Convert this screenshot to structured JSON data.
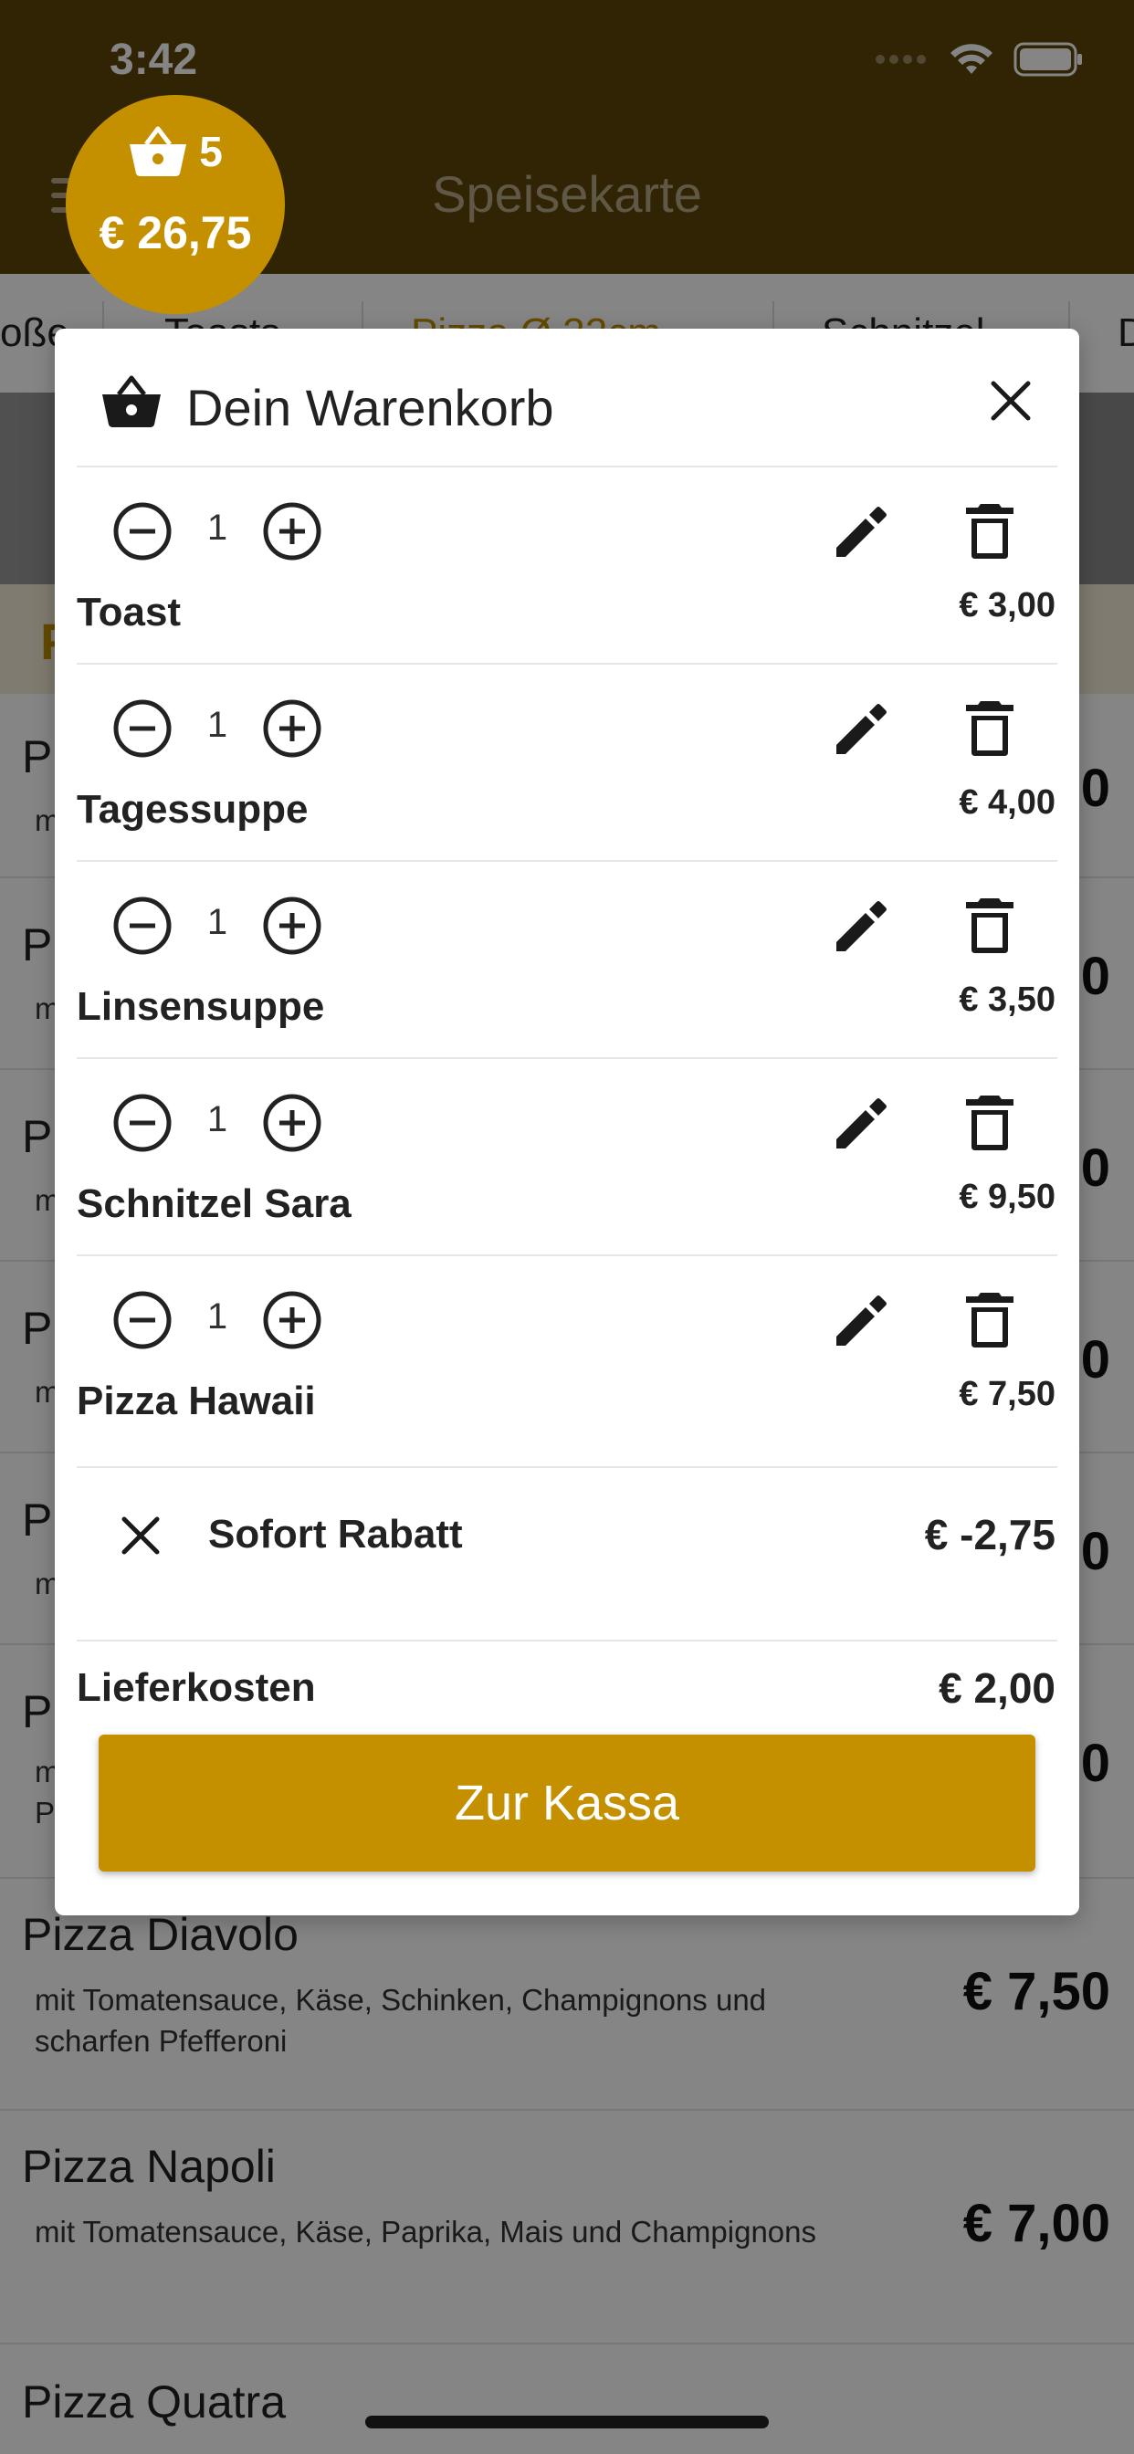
{
  "status_bar": {
    "time": "3:42"
  },
  "header": {
    "title": "Speisekarte"
  },
  "categories": [
    "oße",
    "Toasts",
    "Pizza Ø 32cm",
    "Schnitzel",
    "D"
  ],
  "section_heading": "P",
  "menu": [
    {
      "name": "P",
      "desc": "m",
      "price": "0"
    },
    {
      "name": "P",
      "desc": "m",
      "price": "0"
    },
    {
      "name": "P",
      "desc": "m",
      "price": "0"
    },
    {
      "name": "P",
      "desc": "m",
      "price": "0"
    },
    {
      "name": "P",
      "desc": "m",
      "price": "0"
    },
    {
      "name": "P",
      "desc": "m\nP",
      "price": "0"
    },
    {
      "name": "Pizza Diavolo",
      "desc": "mit Tomatensauce, Käse, Schinken, Champignons und scharfen Pfefferoni",
      "price": "€ 7,50"
    },
    {
      "name": "Pizza Napoli",
      "desc": "mit Tomatensauce, Käse, Paprika, Mais und Champignons",
      "price": "€ 7,00"
    },
    {
      "name": "Pizza Quatra",
      "desc": "",
      "price": ""
    }
  ],
  "cart_badge": {
    "count": "5",
    "total": "€ 26,75"
  },
  "cart": {
    "title": "Dein Warenkorb",
    "items": [
      {
        "qty": "1",
        "name": "Toast",
        "price": "€ 3,00"
      },
      {
        "qty": "1",
        "name": "Tagessuppe",
        "price": "€ 4,00"
      },
      {
        "qty": "1",
        "name": "Linsensuppe",
        "price": "€ 3,50"
      },
      {
        "qty": "1",
        "name": "Schnitzel Sara",
        "price": "€ 9,50"
      },
      {
        "qty": "1",
        "name": "Pizza Hawaii",
        "price": "€ 7,50"
      }
    ],
    "discount": {
      "label": "Sofort Rabatt",
      "value": "€ -2,75"
    },
    "delivery": {
      "label": "Lieferkosten",
      "value": "€ 2,00"
    },
    "checkout_label": "Zur Kassa"
  },
  "colors": {
    "brand_dark": "#5c4508",
    "accent": "#c59000",
    "accent_text": "#c08e00"
  },
  "icons": [
    "basket-icon",
    "close-icon",
    "minus-circle-icon",
    "plus-circle-icon",
    "pencil-icon",
    "trash-icon",
    "menu-icon",
    "wifi-icon",
    "battery-icon"
  ]
}
